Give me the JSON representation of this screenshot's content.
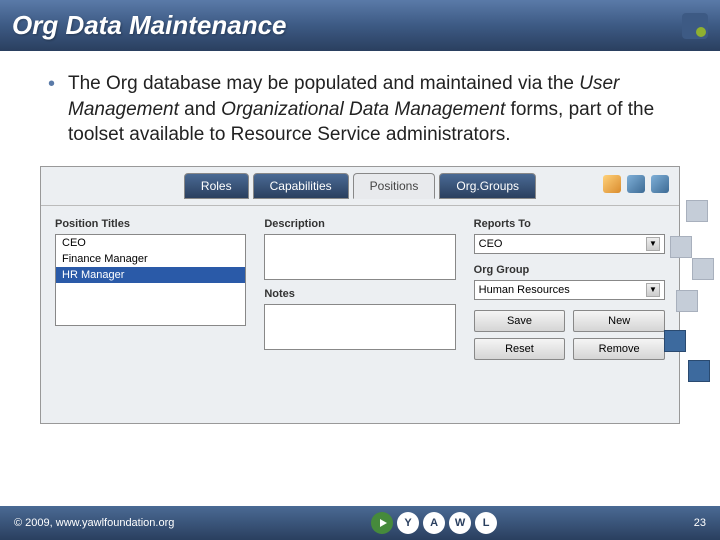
{
  "slide": {
    "title": "Org Data Maintenance",
    "bullet_pre": "The Org database may be populated and maintained via the ",
    "bullet_em1": "User Management",
    "bullet_mid": " and ",
    "bullet_em2": "Organizational Data Management",
    "bullet_post": " forms, part of the toolset available to Resource Service administrators."
  },
  "app": {
    "tabs": {
      "roles": "Roles",
      "capabilities": "Capabilities",
      "positions": "Positions",
      "orggroups": "Org.Groups"
    },
    "section_labels": {
      "titles": "Position Titles",
      "description": "Description",
      "notes": "Notes",
      "reports": "Reports To",
      "orggroup": "Org Group"
    },
    "positions": [
      "CEO",
      "Finance Manager",
      "HR Manager"
    ],
    "selected_position": "HR Manager",
    "reports_to_value": "CEO",
    "org_group_value": "Human Resources",
    "buttons": {
      "save": "Save",
      "new": "New",
      "reset": "Reset",
      "remove": "Remove"
    }
  },
  "footer": {
    "copyright": "© 2009, www.yawlfoundation.org",
    "logo_letters": [
      "Y",
      "A",
      "W",
      "L"
    ],
    "page_num": "23"
  }
}
